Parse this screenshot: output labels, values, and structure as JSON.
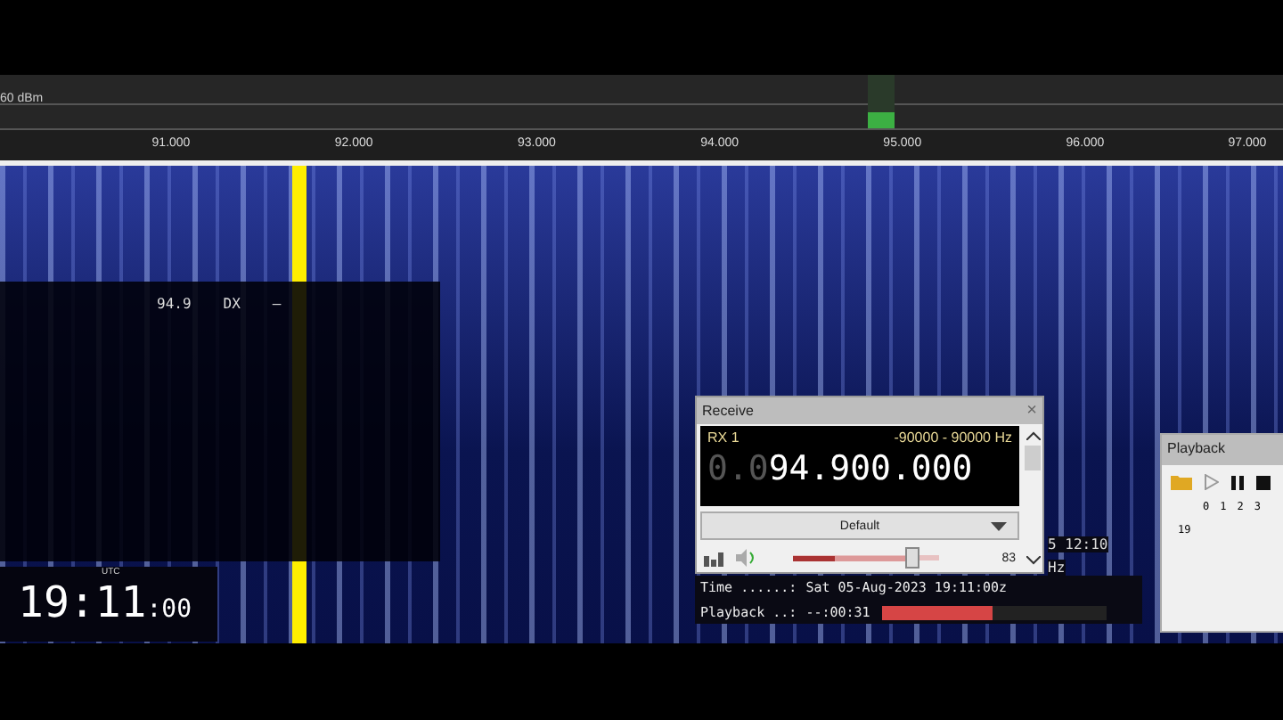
{
  "spectrum": {
    "level_label": "60 dBm",
    "scale": [
      "91.000",
      "92.000",
      "93.000",
      "94.000",
      "95.000",
      "96.000",
      "97.000"
    ]
  },
  "station_overlay": {
    "frequency": "94.9",
    "mode": "DX",
    "name": "–"
  },
  "clock": {
    "zone": "UTC",
    "time": "19:11",
    "seconds": ":00"
  },
  "receive": {
    "title": "Receive",
    "close": "×",
    "rx": "RX 1",
    "range": "-90000 - 90000 Hz",
    "dim_digits": "0.0",
    "digits": "94.900.000",
    "preset": "Default",
    "volume": {
      "level": 0.82,
      "reading": "83"
    }
  },
  "info": {
    "time_label": "Time ......:",
    "time_value": "Sat 05-Aug-2023 19:11:00z",
    "playback_label": "Playback ..:",
    "playback_value": "--:00:31",
    "progress": {
      "level": 0.49
    }
  },
  "partial": [
    "5 12:10",
    "Hz"
  ],
  "playback": {
    "title": "Playback",
    "columns": [
      "0",
      "1",
      "2",
      "3"
    ],
    "row": "19"
  }
}
